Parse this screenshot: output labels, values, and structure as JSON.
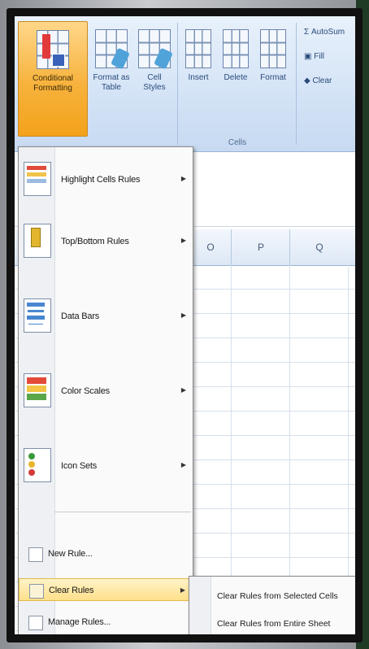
{
  "ribbon": {
    "conditional_formatting": "Conditional Formatting",
    "format_as_table": "Format as Table",
    "cell_styles": "Cell Styles",
    "insert": "Insert",
    "delete": "Delete",
    "format": "Format",
    "cells_group": "Cells",
    "autosum": "AutoSum",
    "fill": "Fill",
    "clear": "Clear"
  },
  "columns": [
    "O",
    "P",
    "Q"
  ],
  "menu": {
    "items": [
      {
        "label": "Highlight Cells Rules",
        "icon": "highlight-cells-icon",
        "has_submenu": true
      },
      {
        "label": "Top/Bottom Rules",
        "icon": "top-bottom-icon",
        "has_submenu": true
      },
      {
        "label": "Data Bars",
        "icon": "data-bars-icon",
        "has_submenu": true
      },
      {
        "label": "Color Scales",
        "icon": "color-scales-icon",
        "has_submenu": true
      },
      {
        "label": "Icon Sets",
        "icon": "icon-sets-icon",
        "has_submenu": true
      }
    ],
    "new_rule": "New Rule...",
    "clear_rules": "Clear Rules",
    "manage_rules": "Manage Rules..."
  },
  "submenu": {
    "items": [
      "Clear Rules from Selected Cells",
      "Clear Rules from Entire Sheet"
    ]
  },
  "colors": {
    "ribbon": "#d3e3f6",
    "highlight": "#ffe08a",
    "cf_button": "#f7b23c"
  }
}
